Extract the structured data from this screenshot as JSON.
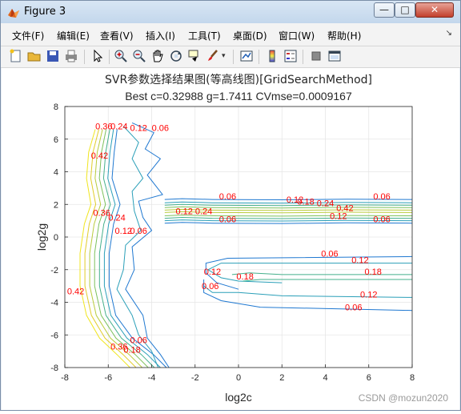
{
  "window": {
    "title": "Figure 3",
    "minimize_glyph": "—",
    "maximize_glyph": "□",
    "close_glyph": "✕"
  },
  "menu": [
    "文件(F)",
    "编辑(E)",
    "查看(V)",
    "插入(I)",
    "工具(T)",
    "桌面(D)",
    "窗口(W)",
    "帮助(H)"
  ],
  "toolbar_icons": [
    "new-figure-icon",
    "open-file-icon",
    "save-icon",
    "print-icon",
    "pointer-icon",
    "zoom-in-icon",
    "zoom-out-icon",
    "pan-icon",
    "rotate-3d-icon",
    "data-cursor-icon",
    "brush-icon",
    "link-plot-icon",
    "colorbar-icon",
    "legend-icon",
    "hide-plot-tools-icon",
    "show-plot-tools-icon"
  ],
  "watermark": "CSDN @mozun2020",
  "chart_data": {
    "type": "contour",
    "title": "SVR参数选择结果图(等高线图)[GridSearchMethod]",
    "subtitle": "Best c=0.32988 g=1.7411 CVmse=0.0009167",
    "xlabel": "log2c",
    "ylabel": "log2g",
    "xlim": [
      -8,
      8
    ],
    "ylim": [
      -8,
      8
    ],
    "xticks": [
      -8,
      -6,
      -4,
      -2,
      0,
      2,
      4,
      6,
      8
    ],
    "yticks": [
      -8,
      -6,
      -4,
      -2,
      0,
      2,
      4,
      6,
      8
    ],
    "grid": true,
    "contour_levels": [
      0.06,
      0.12,
      0.18,
      0.24,
      0.3,
      0.36,
      0.42
    ],
    "level_colors": [
      "#1f78d1",
      "#2a9fb8",
      "#45b08c",
      "#7cc05b",
      "#b9cb3c",
      "#e1cc2a",
      "#f0e51e"
    ],
    "label_color": "#ff0000",
    "contour_labels": [
      {
        "text": "0.36",
        "x": -6.2,
        "y": 6.6
      },
      {
        "text": "0.24",
        "x": -5.5,
        "y": 6.6
      },
      {
        "text": "0.12",
        "x": -4.6,
        "y": 6.5
      },
      {
        "text": "0.06",
        "x": -3.6,
        "y": 6.5
      },
      {
        "text": "0.42",
        "x": -6.4,
        "y": 4.8
      },
      {
        "text": "0.06",
        "x": -0.5,
        "y": 2.3
      },
      {
        "text": "0.12",
        "x": 2.6,
        "y": 2.1
      },
      {
        "text": "0.18",
        "x": 3.1,
        "y": 2.0
      },
      {
        "text": "0.24",
        "x": 4.0,
        "y": 1.9
      },
      {
        "text": "0.06",
        "x": 6.6,
        "y": 2.3
      },
      {
        "text": "0.12",
        "x": -2.5,
        "y": 1.4
      },
      {
        "text": "0.24",
        "x": -1.6,
        "y": 1.4
      },
      {
        "text": "0.42",
        "x": 4.9,
        "y": 1.6
      },
      {
        "text": "0.12",
        "x": 4.6,
        "y": 1.1
      },
      {
        "text": "0.06",
        "x": -0.5,
        "y": 0.9
      },
      {
        "text": "0.06",
        "x": 6.6,
        "y": 0.9
      },
      {
        "text": "0.36",
        "x": -6.3,
        "y": 1.3
      },
      {
        "text": "0.24",
        "x": -5.6,
        "y": 1.0
      },
      {
        "text": "0.12",
        "x": -5.3,
        "y": 0.2
      },
      {
        "text": "0.06",
        "x": -4.6,
        "y": 0.2
      },
      {
        "text": "0.06",
        "x": 4.2,
        "y": -1.2
      },
      {
        "text": "0.12",
        "x": 5.6,
        "y": -1.6
      },
      {
        "text": "0.18",
        "x": 6.2,
        "y": -2.3
      },
      {
        "text": "0.12",
        "x": -1.2,
        "y": -2.3
      },
      {
        "text": "0.18",
        "x": 0.3,
        "y": -2.6
      },
      {
        "text": "0.06",
        "x": -1.3,
        "y": -3.2
      },
      {
        "text": "0.12",
        "x": 6.0,
        "y": -3.7
      },
      {
        "text": "0.06",
        "x": 5.3,
        "y": -4.5
      },
      {
        "text": "0.42",
        "x": -7.5,
        "y": -3.5
      },
      {
        "text": "0.06",
        "x": -4.6,
        "y": -6.5
      },
      {
        "text": "0.36",
        "x": -5.5,
        "y": -6.9
      },
      {
        "text": "0.18",
        "x": -4.9,
        "y": -7.1
      }
    ]
  }
}
